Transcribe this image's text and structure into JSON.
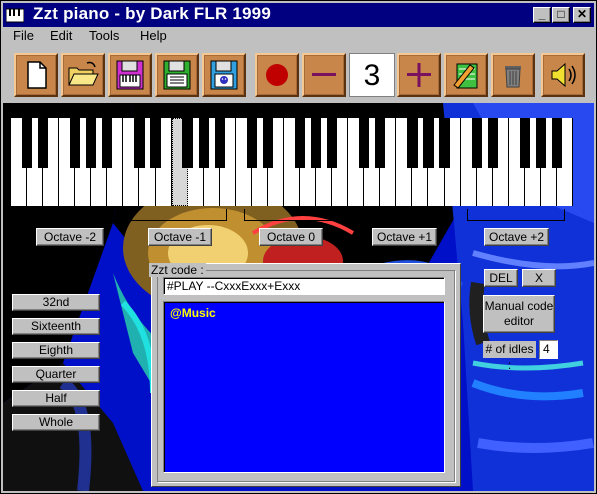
{
  "window": {
    "title": "Zzt piano - by Dark FLR 1999",
    "controls": {
      "minimize": "_",
      "maximize": "□",
      "close": "✕"
    }
  },
  "menu": [
    "File",
    "Edit",
    "Tools",
    "Help"
  ],
  "toolbar": {
    "buttons": [
      {
        "icon": "new-file-icon"
      },
      {
        "icon": "open-folder-icon"
      },
      {
        "icon": "save-keyboard-disk-icon"
      },
      {
        "icon": "save-text-disk-icon"
      },
      {
        "icon": "save-zzt-disk-icon"
      },
      {
        "icon": "record-icon"
      },
      {
        "icon": "minus-icon"
      },
      {
        "icon": "plus-icon"
      },
      {
        "icon": "notes-editor-icon"
      },
      {
        "icon": "trash-icon"
      },
      {
        "icon": "speaker-icon"
      }
    ],
    "octave_value": "3"
  },
  "octaves": [
    "Octave -2",
    "Octave -1",
    "Octave 0",
    "Octave +1",
    "Octave +2"
  ],
  "durations": [
    "32nd",
    "Sixteenth",
    "Eighth",
    "Quarter",
    "Half",
    "Whole"
  ],
  "code": {
    "group_label": "Zzt code :",
    "input_value": "#PLAY --CxxxExxx+Exxx",
    "text": "@Music"
  },
  "right": {
    "del_label": "DEL",
    "x_label": "X",
    "manual_line1": "Manual code",
    "manual_line2": "editor",
    "idles_label": "# of idles :",
    "idles_value": "4"
  },
  "colors": {
    "titlebar": "#000080",
    "code_bg": "#0000ff",
    "code_text": "#ffff00",
    "toolbar_button": "#c8864a"
  }
}
